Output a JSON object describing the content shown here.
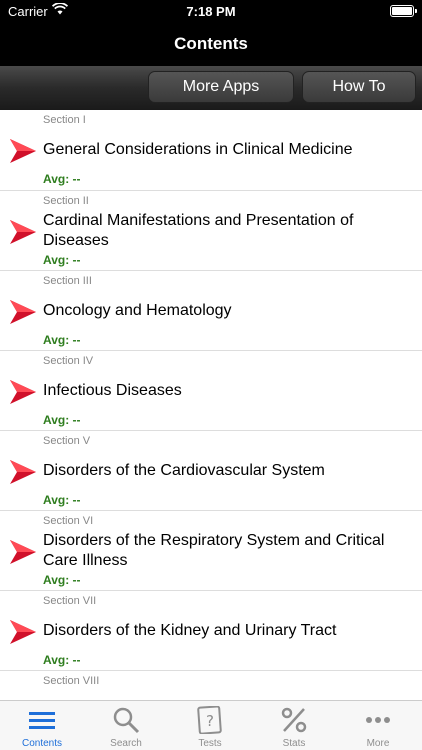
{
  "status": {
    "carrier": "Carrier",
    "time": "7:18 PM"
  },
  "nav": {
    "title": "Contents"
  },
  "toolbar": {
    "more_apps": "More Apps",
    "how_to": "How To"
  },
  "sections": [
    {
      "section": "Section I",
      "title": "General Considerations in Clinical Medicine",
      "avg": "Avg: --"
    },
    {
      "section": "Section II",
      "title": "Cardinal Manifestations and Presentation of Diseases",
      "avg": "Avg: --"
    },
    {
      "section": "Section III",
      "title": "Oncology and Hematology",
      "avg": "Avg: --"
    },
    {
      "section": "Section IV",
      "title": "Infectious Diseases",
      "avg": "Avg: --"
    },
    {
      "section": "Section V",
      "title": "Disorders of the Cardiovascular System",
      "avg": "Avg: --"
    },
    {
      "section": "Section VI",
      "title": "Disorders of the Respiratory System and Critical Care Illness",
      "avg": "Avg: --"
    },
    {
      "section": "Section VII",
      "title": "Disorders of the Kidney and Urinary Tract",
      "avg": "Avg: --"
    },
    {
      "section": "Section VIII",
      "title": "",
      "avg": ""
    }
  ],
  "tabs": [
    {
      "label": "Contents",
      "icon": "list-icon",
      "active": true
    },
    {
      "label": "Search",
      "icon": "magnifier-icon",
      "active": false
    },
    {
      "label": "Tests",
      "icon": "question-card-icon",
      "active": false
    },
    {
      "label": "Stats",
      "icon": "percent-icon",
      "active": false
    },
    {
      "label": "More",
      "icon": "ellipsis-icon",
      "active": false
    }
  ],
  "colors": {
    "accent": "#1e6fd9",
    "avg_green": "#2e7d1e",
    "arrow_red": "#d0102a"
  }
}
